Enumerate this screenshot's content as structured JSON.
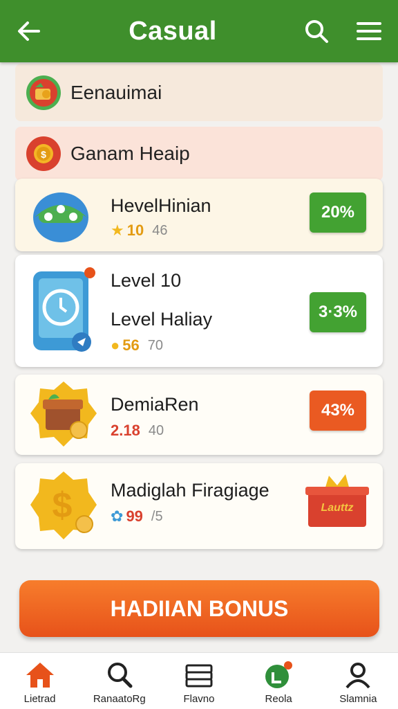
{
  "header": {
    "title": "Casual",
    "back_icon": "arrow-left-icon",
    "search_icon": "search-icon",
    "menu_icon": "hamburger-menu-icon"
  },
  "categories": [
    {
      "label": "Eenauimai",
      "icon": "shop-badge-icon"
    },
    {
      "label": "Ganam Heaip",
      "icon": "coin-badge-icon"
    }
  ],
  "games": [
    {
      "name": "HevelHinian",
      "stat": "10",
      "stat_sub": "46",
      "badge": "20%",
      "badge_color": "#43a232"
    },
    {
      "name": "Level 10",
      "name2": "Level Haliay",
      "stat": "56",
      "stat_sub": "70",
      "badge": "3·3%",
      "badge_color": "#43a232"
    },
    {
      "name": "DemiaRen",
      "stat": "2.18",
      "stat_sub": "40",
      "badge": "43%",
      "badge_color": "#ea5a22"
    },
    {
      "name": "Madiglah Firagiage",
      "stat": "99",
      "stat_sub": "/5",
      "badge_text": "Lauttz"
    }
  ],
  "bonus": {
    "label": "HADIIAN BONUS"
  },
  "nav": [
    {
      "label": "Lietrad",
      "icon": "home-icon"
    },
    {
      "label": "RanaatoRg",
      "icon": "search-icon"
    },
    {
      "label": "Flavno",
      "icon": "stack-icon"
    },
    {
      "label": "Reola",
      "icon": "notification-app-icon"
    },
    {
      "label": "Slamnia",
      "icon": "profile-icon"
    }
  ],
  "colors": {
    "primary": "#3f8f2c",
    "accent": "#e7521a",
    "gold": "#f2b81e"
  }
}
